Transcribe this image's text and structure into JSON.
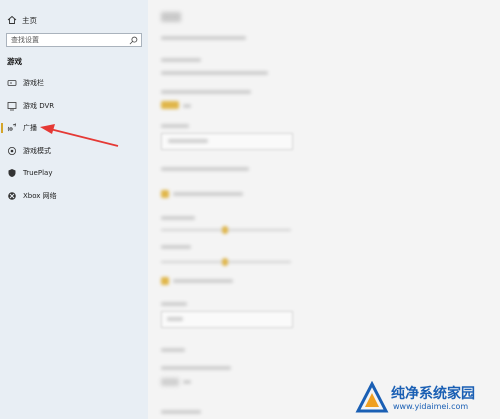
{
  "sidebar": {
    "home_label": "主页",
    "search_placeholder": "查找设置",
    "section_title": "游戏",
    "items": [
      {
        "label": "游戏栏",
        "icon": "game-bar-icon"
      },
      {
        "label": "游戏 DVR",
        "icon": "dvr-icon"
      },
      {
        "label": "广播",
        "icon": "broadcast-icon",
        "selected": true
      },
      {
        "label": "游戏模式",
        "icon": "game-mode-icon"
      },
      {
        "label": "TruePlay",
        "icon": "trueplay-icon"
      },
      {
        "label": "Xbox 网络",
        "icon": "xbox-icon"
      }
    ]
  },
  "main": {
    "title": "广播"
  },
  "watermark": {
    "title": "纯净系统家园",
    "url": "www.yidaimei.com"
  },
  "colors": {
    "accent": "#d4a52a",
    "arrow": "#e53935",
    "watermark": "#1a5fb4"
  }
}
